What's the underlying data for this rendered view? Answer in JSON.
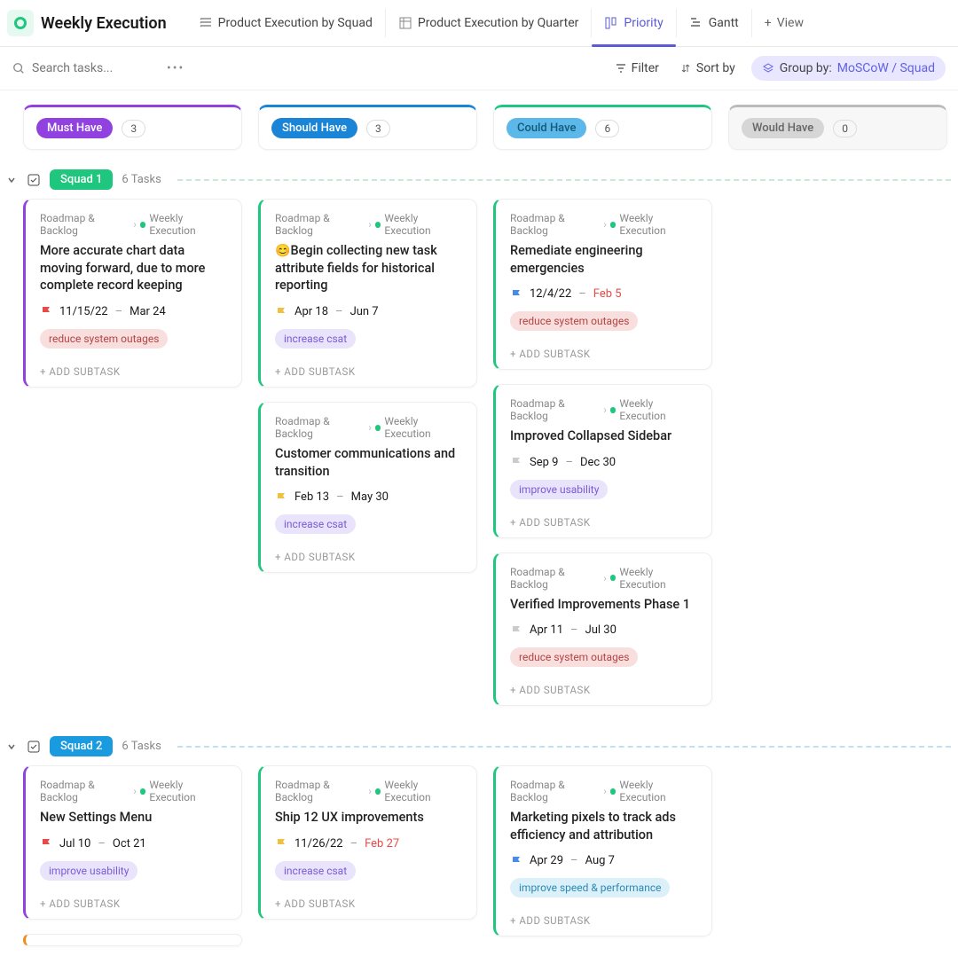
{
  "header": {
    "title": "Weekly Execution",
    "tabs": [
      {
        "label": "Product Execution by Squad"
      },
      {
        "label": "Product Execution by Quarter"
      },
      {
        "label": "Priority"
      },
      {
        "label": "Gantt"
      }
    ],
    "add_view": "View"
  },
  "toolbar": {
    "search_placeholder": "Search tasks...",
    "filter": "Filter",
    "sort": "Sort by",
    "group_label": "Group by:",
    "group_value": "MoSCoW / Squad"
  },
  "columns": [
    {
      "label": "Must Have",
      "count": "3"
    },
    {
      "label": "Should Have",
      "count": "3"
    },
    {
      "label": "Could Have",
      "count": "6"
    },
    {
      "label": "Would Have",
      "count": "0"
    }
  ],
  "groups": [
    {
      "name": "Squad 1",
      "task_count": "6 Tasks",
      "rows": {
        "must": [
          {
            "bc1": "Roadmap & Backlog",
            "bc2": "Weekly Execution",
            "title": "More accurate chart data moving forward, due to more complete record keeping",
            "flag": "red",
            "d1": "11/15/22",
            "d2": "Mar 24",
            "tag": "reduce system outages",
            "tagc": "red",
            "sub": "ADD SUBTASK"
          }
        ],
        "should": [
          {
            "bc1": "Roadmap & Backlog",
            "bc2": "Weekly Execution",
            "emoji": "😊",
            "title": "Begin collecting new task attribute fields for historical reporting",
            "flag": "yellow",
            "d1": "Apr 18",
            "d2": "Jun 7",
            "tag": "increase csat",
            "tagc": "purple",
            "sub": "ADD SUBTASK"
          },
          {
            "bc1": "Roadmap & Backlog",
            "bc2": "Weekly Execution",
            "title": "Customer communications and transition",
            "flag": "yellow",
            "d1": "Feb 13",
            "d2": "May 30",
            "tag": "increase csat",
            "tagc": "purple",
            "sub": "ADD SUBTASK"
          }
        ],
        "could": [
          {
            "bc1": "Roadmap & Backlog",
            "bc2": "Weekly Execution",
            "title": "Remediate engineering emergencies",
            "flag": "blue",
            "d1": "12/4/22",
            "d2": "Feb 5",
            "overdue": true,
            "tag": "reduce system outages",
            "tagc": "red",
            "sub": "ADD SUBTASK"
          },
          {
            "bc1": "Roadmap & Backlog",
            "bc2": "Weekly Execution",
            "title": "Improved Collapsed Sidebar",
            "flag": "gray",
            "d1": "Sep 9",
            "d2": "Dec 30",
            "tag": "improve usability",
            "tagc": "purple",
            "sub": "ADD SUBTASK"
          },
          {
            "bc1": "Roadmap & Backlog",
            "bc2": "Weekly Execution",
            "title": "Verified Improvements Phase 1",
            "flag": "gray",
            "d1": "Apr 11",
            "d2": "Jul 30",
            "tag": "reduce system outages",
            "tagc": "red",
            "sub": "ADD SUBTASK"
          }
        ]
      }
    },
    {
      "name": "Squad 2",
      "task_count": "6 Tasks",
      "rows": {
        "must": [
          {
            "bc1": "Roadmap & Backlog",
            "bc2": "Weekly Execution",
            "title": "New Settings Menu",
            "flag": "red",
            "d1": "Jul 10",
            "d2": "Oct 21",
            "tag": "improve usability",
            "tagc": "purple",
            "sub": "ADD SUBTASK"
          }
        ],
        "should": [
          {
            "bc1": "Roadmap & Backlog",
            "bc2": "Weekly Execution",
            "title": "Ship 12 UX improvements",
            "flag": "yellow",
            "d1": "11/26/22",
            "d2": "Feb 27",
            "overdue": true,
            "tag": "increase csat",
            "tagc": "purple",
            "sub": "ADD SUBTASK"
          }
        ],
        "could": [
          {
            "bc1": "Roadmap & Backlog",
            "bc2": "Weekly Execution",
            "title": "Marketing pixels to track ads efficiency and attribution",
            "flag": "blue",
            "d1": "Apr 29",
            "d2": "Aug 7",
            "tag": "improve speed & performance",
            "tagc": "blue",
            "sub": "ADD SUBTASK"
          }
        ]
      }
    }
  ]
}
